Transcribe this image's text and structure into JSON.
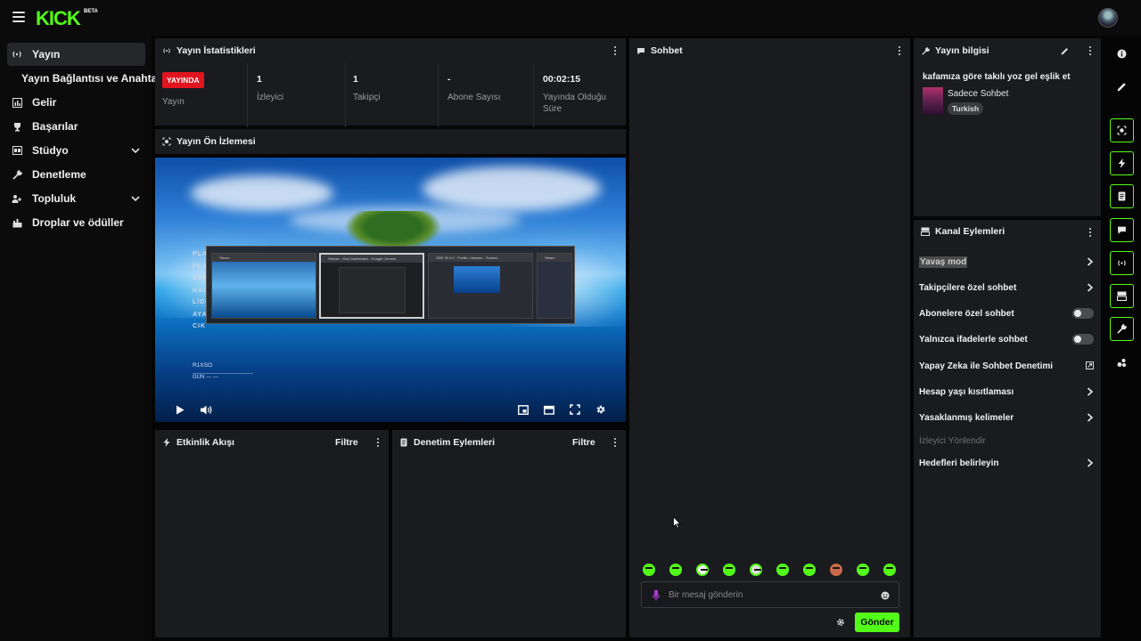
{
  "brand": {
    "logo_text": "KICK",
    "logo_badge": "BETA",
    "accent": "#53fc18",
    "live_red": "#e0151f"
  },
  "sidebar": {
    "items": [
      {
        "label": "Yayın",
        "icon": "broadcast-icon"
      },
      {
        "label": "Yayın Bağlantısı ve Anahtarı",
        "icon": ""
      },
      {
        "label": "Gelir",
        "icon": "chart-icon"
      },
      {
        "label": "Başarılar",
        "icon": "trophy-icon"
      },
      {
        "label": "Stüdyo",
        "icon": "studio-icon"
      },
      {
        "label": "Denetleme",
        "icon": "wrench-icon"
      },
      {
        "label": "Topluluk",
        "icon": "users-icon"
      },
      {
        "label": "Droplar ve ödüller",
        "icon": "gift-icon"
      }
    ]
  },
  "stats": {
    "title": "Yayın İstatistikleri",
    "live_badge": "YAYINDA",
    "live_label": "Yayın",
    "viewers": {
      "value": "1",
      "label": "İzleyici"
    },
    "followers": {
      "value": "1",
      "label": "Takipçi"
    },
    "subs": {
      "value": "-",
      "label": "Abone Sayısı"
    },
    "uptime": {
      "value": "00:02:15",
      "label": "Yayında Olduğu Süre"
    }
  },
  "preview": {
    "title": "Yayın Ön İzlemesi",
    "game_menu": [
      "PLA",
      "PLA",
      "CHA",
      "HAI",
      "LIDE",
      "AYA",
      "CIK"
    ],
    "game_name": "R1XSO",
    "game_gun": "GUN  ---   ---",
    "windows": [
      "Steam",
      "Stream - Kick Dashboard - Google Chrome",
      "OBS 30.0.0 - Profile: Ustsone - Scenes",
      "Steam"
    ]
  },
  "activity": {
    "title": "Etkinlik Akışı",
    "filter": "Filtre"
  },
  "moderation": {
    "title": "Denetim Eylemleri",
    "filter": "Filtre"
  },
  "chat": {
    "title": "Sohbet",
    "placeholder": "Bir mesaj gönderin",
    "send": "Gönder"
  },
  "stream_info": {
    "title": "Yayın bilgisi",
    "stream_title": "kafamıza göre takılı yoz gel eşlik et",
    "category": "Sadece Sohbet",
    "tag": "Turkish"
  },
  "channel_actions": {
    "title": "Kanal Eylemleri",
    "items": [
      {
        "label": "Yavaş mod",
        "kind": "chevron"
      },
      {
        "label": "Takipçilere özel sohbet",
        "kind": "chevron"
      },
      {
        "label": "Abonelere özel sohbet",
        "kind": "toggle"
      },
      {
        "label": "Yalnızca ifadelerle sohbet",
        "kind": "toggle"
      },
      {
        "label": "Yapay Zeka ile Sohbet Denetimi",
        "kind": "external"
      },
      {
        "label": "Hesap yaşı kısıtlaması",
        "kind": "chevron"
      },
      {
        "label": "Yasaklanmış kelimeler",
        "kind": "chevron"
      },
      {
        "label": "İzleyici Yönlendir",
        "kind": "disabled"
      },
      {
        "label": "Hedefleri belirleyin",
        "kind": "chevron"
      }
    ]
  }
}
